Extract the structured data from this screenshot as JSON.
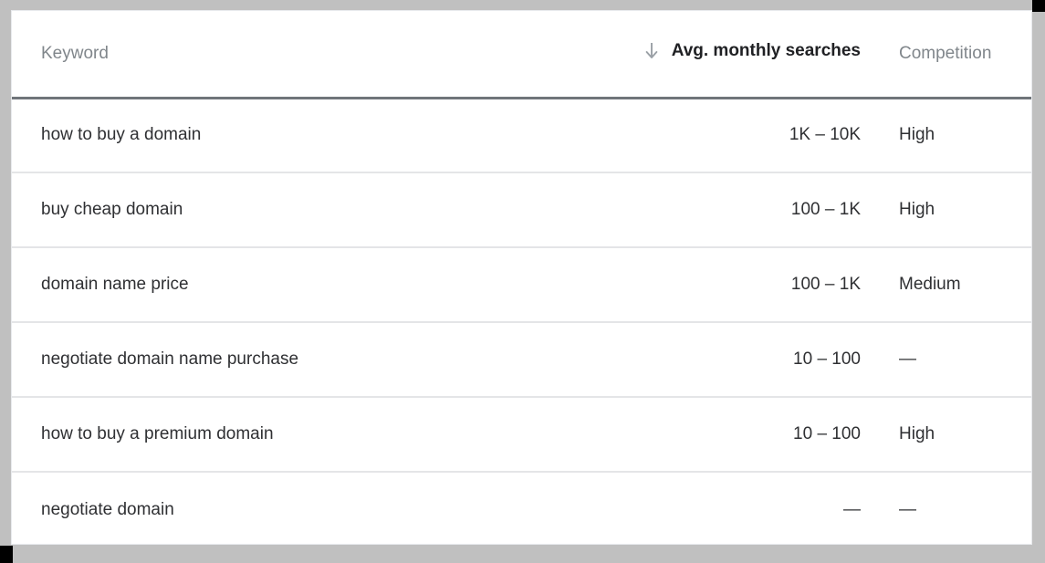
{
  "table": {
    "columns": [
      {
        "key": "keyword",
        "label": "Keyword",
        "align": "left",
        "emphasis": "normal"
      },
      {
        "key": "searches",
        "label": "Avg. monthly searches",
        "align": "right",
        "emphasis": "bold",
        "sort_icon": "arrow-down-icon",
        "sort_direction": "descending"
      },
      {
        "key": "competition",
        "label": "Competition",
        "align": "left",
        "emphasis": "normal"
      }
    ],
    "rows": [
      {
        "keyword": "how to buy a domain",
        "searches": "1K – 10K",
        "competition": "High"
      },
      {
        "keyword": "buy cheap domain",
        "searches": "100 – 1K",
        "competition": "High"
      },
      {
        "keyword": "domain name price",
        "searches": "100 – 1K",
        "competition": "Medium"
      },
      {
        "keyword": "negotiate domain name purchase",
        "searches": "10 – 100",
        "competition": "—"
      },
      {
        "keyword": "how to buy a premium domain",
        "searches": "10 – 100",
        "competition": "High"
      },
      {
        "keyword": "negotiate domain",
        "searches": "—",
        "competition": "—"
      }
    ]
  },
  "colors": {
    "page_background": "#c0c0c0",
    "card_background": "#ffffff",
    "header_text_muted": "#80868b",
    "header_text_strong": "#202124",
    "header_rule": "#70757a",
    "row_divider": "#e4e5e7",
    "body_text": "#2f3033",
    "sort_icon": "#9aa0a6"
  }
}
